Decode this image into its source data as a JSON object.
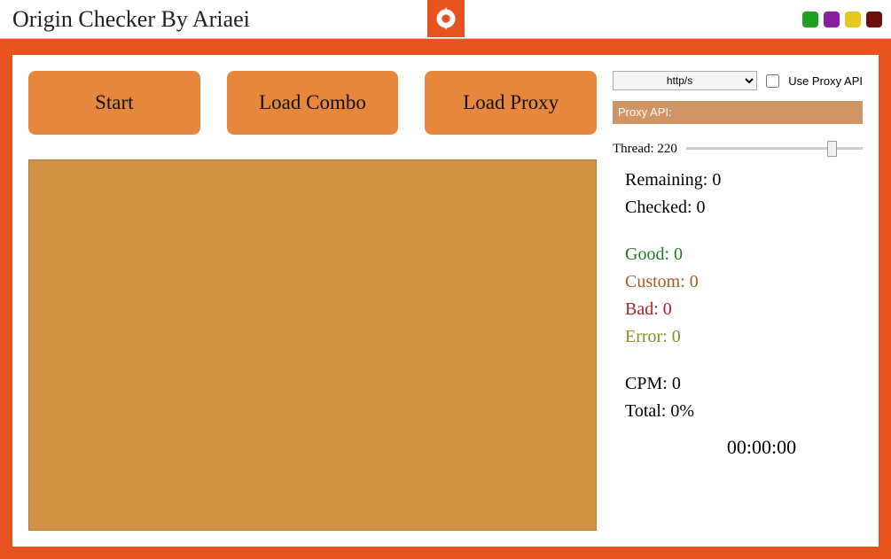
{
  "title": "Origin Checker By Ariaei",
  "buttons": {
    "start": "Start",
    "load_combo": "Load Combo",
    "load_proxy": "Load Proxy"
  },
  "proxy": {
    "type_selected": "http/s",
    "use_api_label": "Use Proxy API",
    "api_label": "Proxy API:"
  },
  "thread": {
    "label": "Thread:",
    "value": "220"
  },
  "stats": {
    "remaining_label": "Remaining:",
    "remaining_value": "0",
    "checked_label": "Checked:",
    "checked_value": "0",
    "good_label": "Good:",
    "good_value": "0",
    "custom_label": "Custom:",
    "custom_value": "0",
    "bad_label": "Bad:",
    "bad_value": "0",
    "error_label": "Error:",
    "error_value": "0",
    "cpm_label": "CPM:",
    "cpm_value": "0",
    "total_label": "Total:",
    "total_value": "0%"
  },
  "timer": "00:00:00"
}
